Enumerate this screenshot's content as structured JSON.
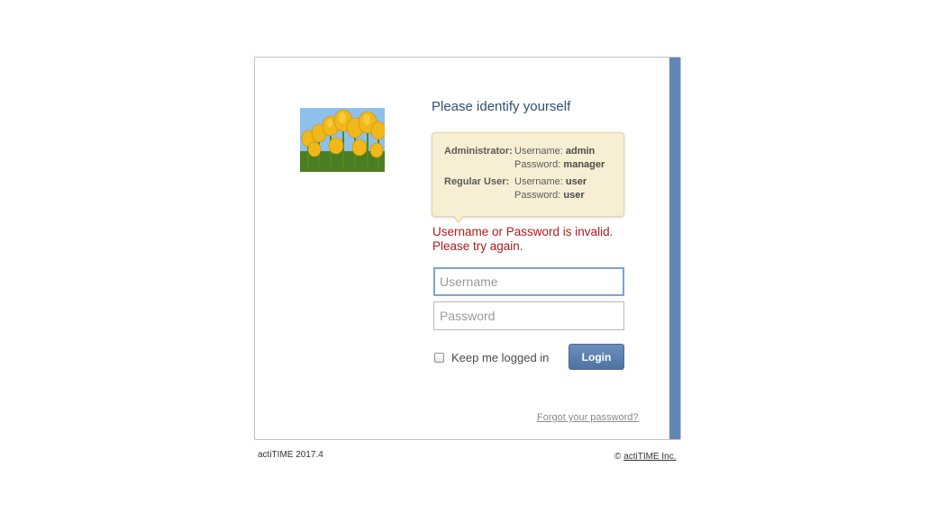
{
  "login": {
    "heading": "Please identify yourself",
    "hint": {
      "admin_role": "Administrator:",
      "admin_user_label": "Username: ",
      "admin_user_value": "admin",
      "admin_pass_label": "Password: ",
      "admin_pass_value": "manager",
      "user_role": "Regular User:",
      "user_user_label": "Username: ",
      "user_user_value": "user",
      "user_pass_label": "Password: ",
      "user_pass_value": "user"
    },
    "error_line1": "Username or Password is invalid.",
    "error_line2": "Please try again.",
    "username_placeholder": "Username",
    "password_placeholder": "Password",
    "remember_label": "Keep me logged in",
    "login_button": "Login",
    "forgot_link": "Forgot your password?"
  },
  "footer": {
    "version": "actiTIME 2017.4",
    "copyright_symbol": "©",
    "copyright_link": "actiTIME Inc."
  },
  "colors": {
    "accent_stripe": "#6387b4",
    "error": "#b01a1a",
    "heading": "#31506f",
    "hint_background": "#f7efd3"
  }
}
